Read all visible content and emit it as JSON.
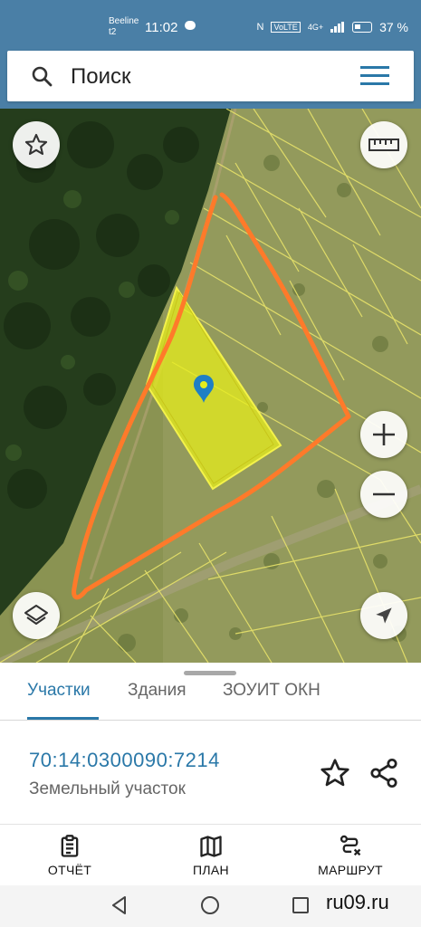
{
  "status_bar": {
    "carrier_1": "Beeline",
    "carrier_2": "t2",
    "time": "11:02",
    "nfc": "N",
    "volte": "VoLTE",
    "network": "4G+",
    "battery": "37 %"
  },
  "search": {
    "placeholder": "Поиск"
  },
  "map": {
    "parcel_color": "#e6ec1c",
    "outline_color": "#ff7a2a",
    "pin_color": "#1f7fc4"
  },
  "sheet": {
    "tabs": [
      {
        "label": "Участки",
        "active": true
      },
      {
        "label": "Здания",
        "active": false
      },
      {
        "label": "ЗОУИТ ОКН",
        "active": false
      }
    ],
    "cadastral_number": "70:14:0300090:7214",
    "object_type": "Земельный участок"
  },
  "bottom_nav": {
    "report": "ОТЧЁТ",
    "plan": "ПЛАН",
    "route": "МАРШРУТ"
  },
  "watermark": "ru09.ru",
  "colors": {
    "brand": "#4a7fa6",
    "accent": "#2a78a8"
  }
}
